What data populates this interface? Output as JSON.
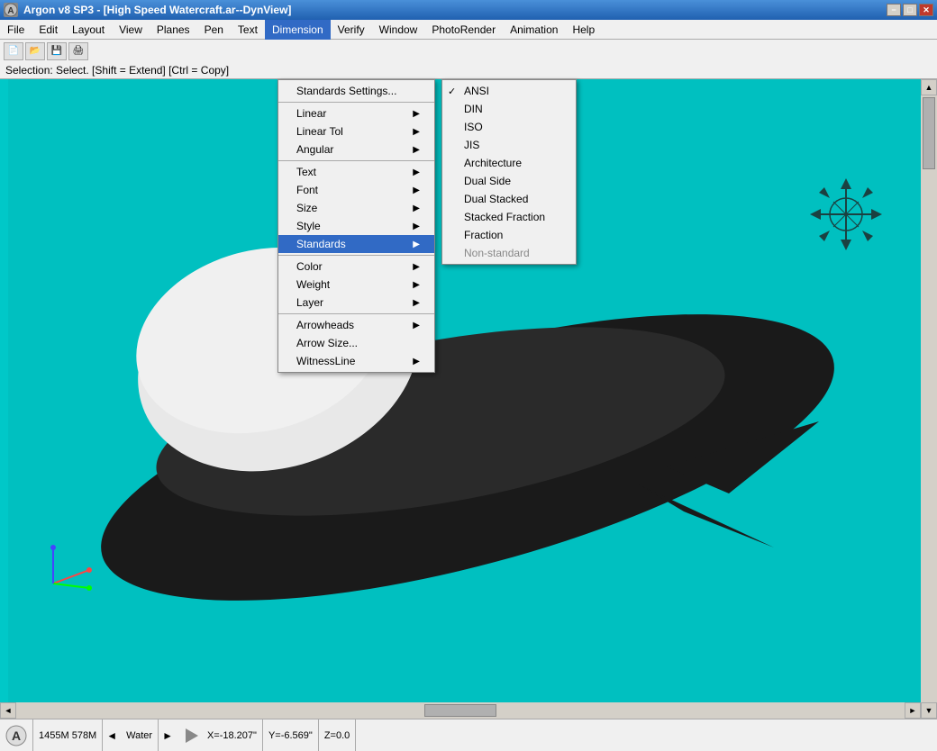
{
  "titlebar": {
    "title": "Argon v8 SP3 - [High Speed Watercraft.ar--DynView]",
    "min_label": "−",
    "max_label": "□",
    "close_label": "✕"
  },
  "menubar": {
    "items": [
      {
        "id": "file",
        "label": "File"
      },
      {
        "id": "edit",
        "label": "Edit"
      },
      {
        "id": "layout",
        "label": "Layout"
      },
      {
        "id": "view",
        "label": "View"
      },
      {
        "id": "planes",
        "label": "Planes"
      },
      {
        "id": "pen",
        "label": "Pen"
      },
      {
        "id": "text",
        "label": "Text"
      },
      {
        "id": "dimension",
        "label": "Dimension",
        "active": true
      },
      {
        "id": "verify",
        "label": "Verify"
      },
      {
        "id": "window",
        "label": "Window"
      },
      {
        "id": "photorender",
        "label": "PhotoRender"
      },
      {
        "id": "animation",
        "label": "Animation"
      },
      {
        "id": "help",
        "label": "Help"
      }
    ]
  },
  "statusbar": {
    "text": "Selection: Select. [Shift = Extend]  [Ctrl = Copy]"
  },
  "dimension_menu": {
    "items": [
      {
        "id": "standards-settings",
        "label": "Standards Settings...",
        "has_arrow": false,
        "separator_after": true
      },
      {
        "id": "linear",
        "label": "Linear",
        "has_arrow": true
      },
      {
        "id": "linear-tol",
        "label": "Linear Tol",
        "has_arrow": true
      },
      {
        "id": "angular",
        "label": "Angular",
        "has_arrow": true,
        "separator_after": true
      },
      {
        "id": "text",
        "label": "Text",
        "has_arrow": true
      },
      {
        "id": "font",
        "label": "Font",
        "has_arrow": true
      },
      {
        "id": "size",
        "label": "Size",
        "has_arrow": true
      },
      {
        "id": "style",
        "label": "Style",
        "has_arrow": true
      },
      {
        "id": "standards",
        "label": "Standards",
        "has_arrow": true,
        "highlighted": true,
        "separator_after": true
      },
      {
        "id": "color",
        "label": "Color",
        "has_arrow": true
      },
      {
        "id": "weight",
        "label": "Weight",
        "has_arrow": true
      },
      {
        "id": "layer",
        "label": "Layer",
        "has_arrow": true,
        "separator_after": true
      },
      {
        "id": "arrowheads",
        "label": "Arrowheads",
        "has_arrow": true
      },
      {
        "id": "arrow-size",
        "label": "Arrow Size...",
        "has_arrow": false
      },
      {
        "id": "witnessline",
        "label": "WitnessLine",
        "has_arrow": true
      }
    ]
  },
  "standards_submenu": {
    "items": [
      {
        "id": "ansi",
        "label": "ANSI",
        "checked": true
      },
      {
        "id": "din",
        "label": "DIN"
      },
      {
        "id": "iso",
        "label": "ISO"
      },
      {
        "id": "jis",
        "label": "JIS"
      },
      {
        "id": "architecture",
        "label": "Architecture"
      },
      {
        "id": "dual-side",
        "label": "Dual Side"
      },
      {
        "id": "dual-stacked",
        "label": "Dual Stacked"
      },
      {
        "id": "stacked-fraction",
        "label": "Stacked Fraction"
      },
      {
        "id": "fraction",
        "label": "Fraction"
      },
      {
        "id": "non-standard",
        "label": "Non-standard",
        "disabled": true
      }
    ]
  },
  "bottombar": {
    "mem1": "1455M",
    "mem2": "578M",
    "layer": "Water",
    "x_label": "X=",
    "x_val": "-18.207\"",
    "y_label": "Y=",
    "y_val": "-6.569\"",
    "z_label": "Z=",
    "z_val": "0.0"
  }
}
